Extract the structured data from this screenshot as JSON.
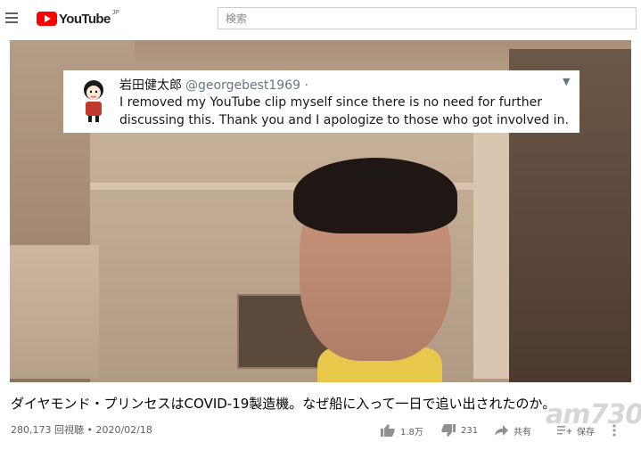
{
  "header": {
    "logo_text": "YouTube",
    "logo_region": "JP",
    "search_placeholder": "検索"
  },
  "video": {
    "tweet": {
      "name": "岩田健太郎",
      "handle": "@georgebest1969 ·",
      "text": "I removed my YouTube clip myself since there is no need for further discussing this. Thank you and I apologize to those who got involved in."
    },
    "title": "ダイヤモンド・プリンセスはCOVID-19製造機。なぜ船に入って一日で追い出されたのか。",
    "views_date": "280,173 回視聴 • 2020/02/18"
  },
  "actions": {
    "like_count": "1.8万",
    "dislike_count": "231",
    "share_label": "共有",
    "save_label": "保存"
  },
  "watermark": "am730",
  "colors": {
    "accent": "#ff0000",
    "meta_text": "#606060"
  }
}
